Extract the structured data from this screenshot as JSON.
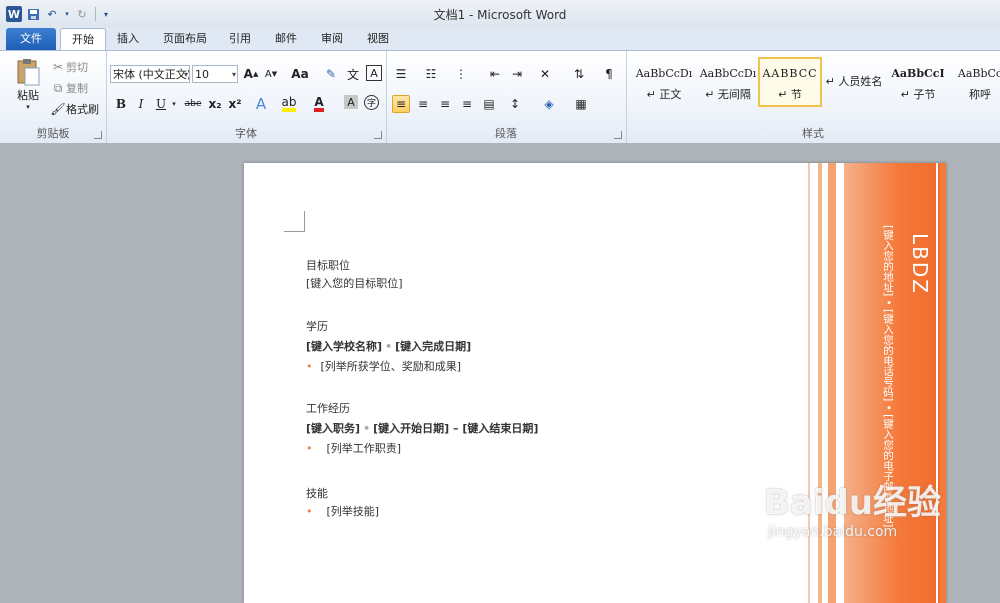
{
  "window": {
    "title": "文档1 - Microsoft Word"
  },
  "qat": {
    "app_icon": "W"
  },
  "tabs": [
    {
      "label": "文件"
    },
    {
      "label": "开始"
    },
    {
      "label": "插入"
    },
    {
      "label": "页面布局"
    },
    {
      "label": "引用"
    },
    {
      "label": "邮件"
    },
    {
      "label": "审阅"
    },
    {
      "label": "视图"
    }
  ],
  "clipboard": {
    "group_label": "剪贴板",
    "paste": "粘贴",
    "cut": "剪切",
    "copy": "复制",
    "format_painter": "格式刷"
  },
  "font": {
    "group_label": "字体",
    "font_name": "宋体 (中文正文)",
    "font_size": "10",
    "change_case": "Aa",
    "bold": "B",
    "italic": "I",
    "underline": "U",
    "strikethrough": "abe",
    "subscript": "x₂",
    "superscript": "x²"
  },
  "paragraph": {
    "group_label": "段落"
  },
  "styles": {
    "group_label": "样式",
    "items": [
      {
        "sample": "AaBbCcDı",
        "name": "↵ 正文"
      },
      {
        "sample": "AaBbCcDı",
        "name": "↵ 无间隔"
      },
      {
        "sample": "AABBCC",
        "name": "↵ 节"
      },
      {
        "sample": "",
        "name": "↵ 人员姓名"
      },
      {
        "sample": "AaBbCcI",
        "name": "↵ 子节"
      },
      {
        "sample": "AaBbCc",
        "name": "称呼"
      }
    ]
  },
  "document": {
    "sections": [
      {
        "title": "目标职位",
        "lines": [
          "[键入您的目标职位]"
        ]
      },
      {
        "title": "学历",
        "school": "[键入学校名称]",
        "date": "[键入完成日期]",
        "bullet": "[列举所获学位、奖励和成果]"
      },
      {
        "title": "工作经历",
        "job": "[键入职务]",
        "start": "[键入开始日期]",
        "dash": "–",
        "end": "[键入结束日期]",
        "bullet": "[列举工作职责]"
      },
      {
        "title": "技能",
        "bullet": "[列举技能]"
      }
    ],
    "band": {
      "name": "LBDZ",
      "contact": "[键入您的地址] • [键入您的电话号码] • [键入您的电子邮件地址]"
    }
  },
  "watermark": {
    "logo": "Baidu经验",
    "url": "jingyan.baidu.com"
  },
  "colors": {
    "accent": "#f47a3a",
    "ribbon_blue": "#2b5797"
  }
}
